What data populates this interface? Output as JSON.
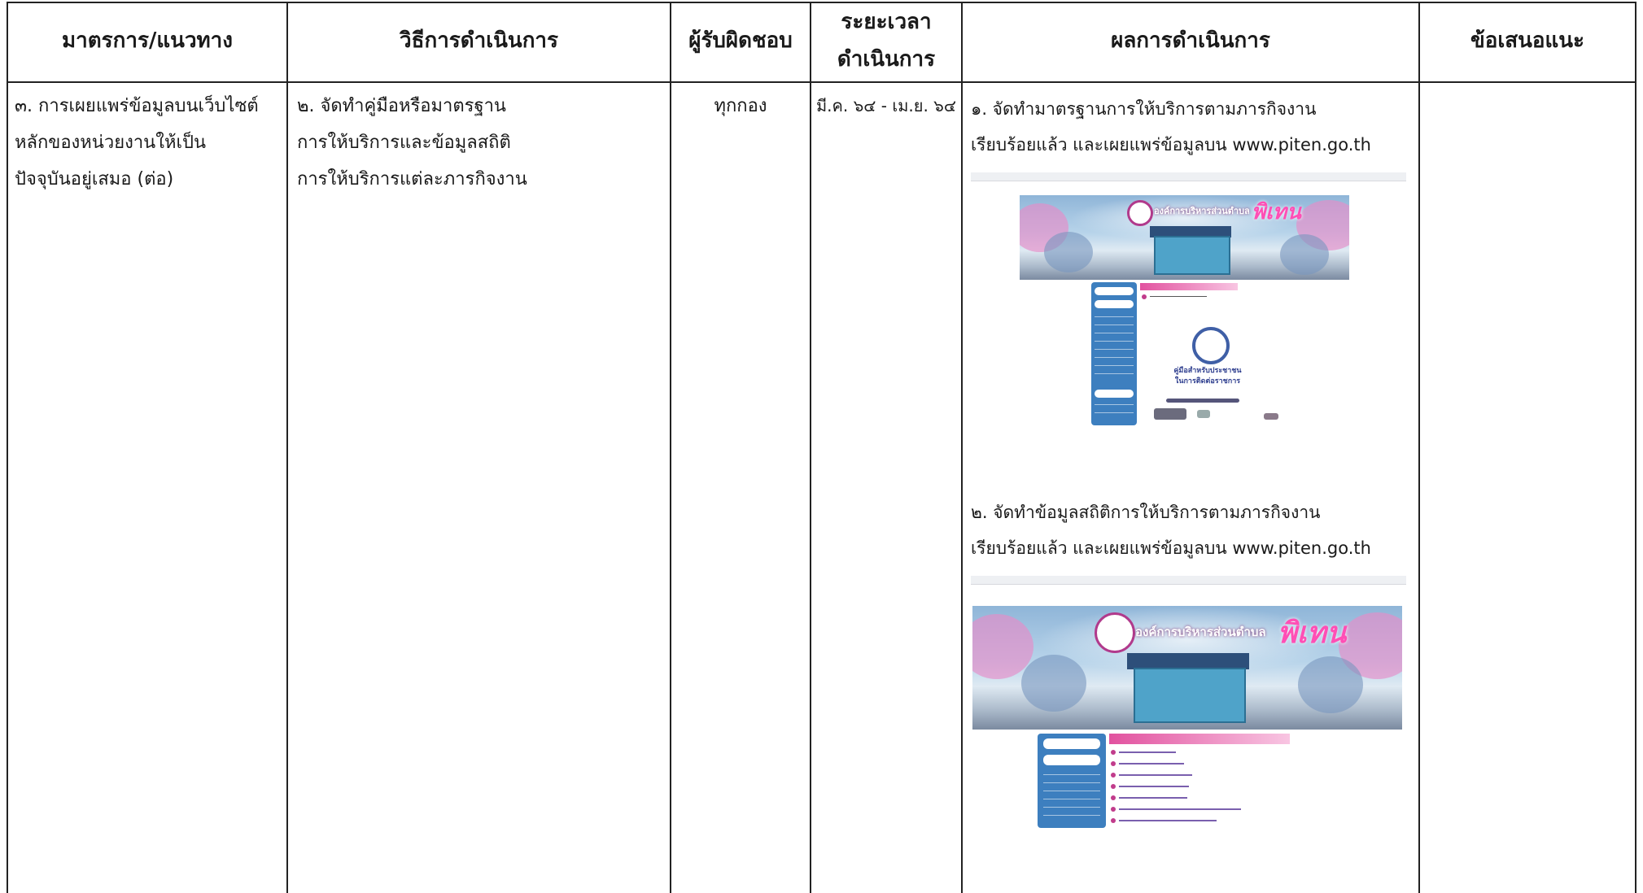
{
  "headers": {
    "col1": "มาตรการ/แนวทาง",
    "col2": "วิธีการดำเนินการ",
    "col3": "ผู้รับผิดชอบ",
    "col4_line1": "ระยะเวลา",
    "col4_line2": "ดำเนินการ",
    "col5": "ผลการดำเนินการ",
    "col6": "ข้อเสนอแนะ"
  },
  "row": {
    "measure": [
      "๓. การเผยแพร่ข้อมูลบนเว็บไซต์",
      "หลักของหน่วยงานให้เป็น",
      "ปัจจุบันอยู่เสมอ (ต่อ)"
    ],
    "method": [
      "๒. จัดทำคู่มือหรือมาตรฐาน",
      "การให้บริการและข้อมูลสถิติ",
      "การให้บริการแต่ละภารกิจงาน"
    ],
    "responsible": "ทุกกอง",
    "period": "มี.ค. ๖๔ - เม.ย. ๖๔",
    "results": {
      "item1": [
        "๑. จัดทำมาตรฐานการให้บริการตามภารกิจงาน",
        "เรียบร้อยแล้ว และเผยแพร่ข้อมูลบน www.piten.go.th"
      ],
      "item2": [
        "๒. จัดทำข้อมูลสถิติการให้บริการตามภารกิจงาน",
        "เรียบร้อยแล้ว และเผยแพร่ข้อมูลบน www.piten.go.th"
      ]
    },
    "suggestion": ""
  },
  "screenshots": {
    "shot1": {
      "banner_title": "องค์การบริหารส่วนตำบล",
      "banner_name": "พิเทน",
      "manual_title": [
        "คู่มือสำหรับประชาชน",
        "ในการติดต่อราชการ"
      ]
    },
    "shot2": {
      "banner_title": "องค์การบริหารส่วนตำบล",
      "banner_name": "พิเทน"
    }
  }
}
